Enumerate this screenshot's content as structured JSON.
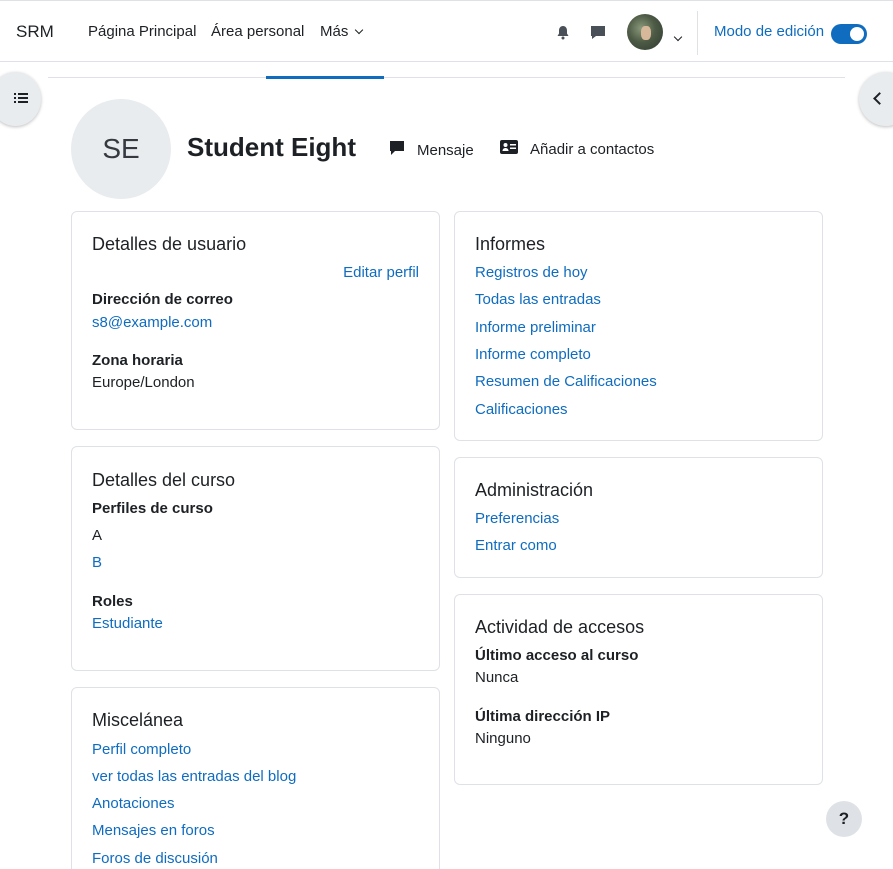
{
  "navbar": {
    "brand": "SRM",
    "links": [
      "Página Principal",
      "Área personal",
      "Más"
    ],
    "edit_mode_label": "Modo de edición",
    "edit_mode_on": true
  },
  "profile": {
    "initials": "SE",
    "full_name": "Student Eight",
    "message_label": "Mensaje",
    "add_contact_label": "Añadir a contactos"
  },
  "user_details": {
    "title": "Detalles de usuario",
    "edit_profile": "Editar perfil",
    "email_label": "Dirección de correo",
    "email_value": "s8@example.com",
    "timezone_label": "Zona horaria",
    "timezone_value": "Europe/London"
  },
  "course_details": {
    "title": "Detalles del curso",
    "profiles_label": "Perfiles de curso",
    "profiles": [
      "A",
      "B"
    ],
    "roles_label": "Roles",
    "role_value": "Estudiante"
  },
  "misc": {
    "title": "Miscelánea",
    "links": [
      "Perfil completo",
      "ver todas las entradas del blog",
      "Anotaciones",
      "Mensajes en foros",
      "Foros de discusión"
    ]
  },
  "reports": {
    "title": "Informes",
    "links": [
      "Registros de hoy",
      "Todas las entradas",
      "Informe preliminar",
      "Informe completo",
      "Resumen de Calificaciones",
      "Calificaciones"
    ]
  },
  "administration": {
    "title": "Administración",
    "links": [
      "Preferencias",
      "Entrar como"
    ]
  },
  "access_activity": {
    "title": "Actividad de accesos",
    "last_course_access_label": "Último acceso al curso",
    "last_course_access_value": "Nunca",
    "last_ip_label": "Última dirección IP",
    "last_ip_value": "Ninguno"
  },
  "help": {
    "label": "?"
  },
  "colors": {
    "link": "#0f6cbf",
    "text": "#1d2125",
    "border": "#dee2e6"
  }
}
